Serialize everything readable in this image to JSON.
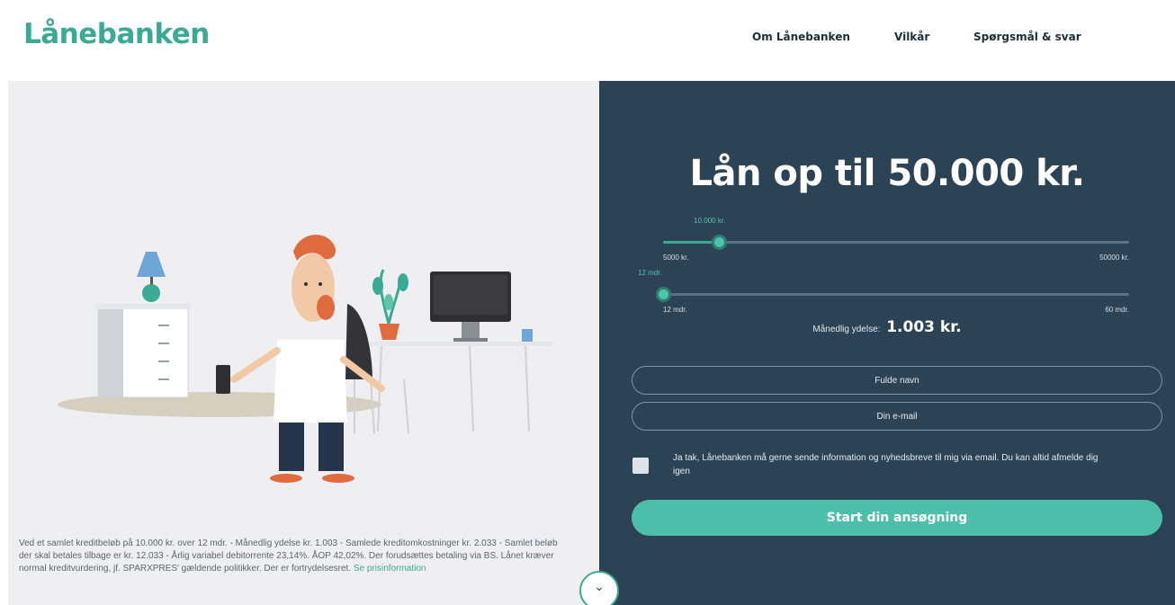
{
  "header": {
    "logo": "Lånebanken",
    "nav": [
      "Om Lånebanken",
      "Vilkår",
      "Spørgsmål & svar"
    ]
  },
  "form": {
    "headline": "Lån op til 50.000 kr.",
    "amount_slider": {
      "value_label": "10.000 kr.",
      "min_label": "5000 kr.",
      "max_label": "50000 kr.",
      "fill_fraction": 0.12
    },
    "term_slider": {
      "value_label": "12 mdr.",
      "min_label": "12 mdr.",
      "max_label": "60 mdr.",
      "fill_fraction": 0.0
    },
    "monthly_label": "Månedlig ydelse:",
    "monthly_value": "1.003 kr.",
    "name_placeholder": "Fulde navn",
    "email_placeholder": "Din e-mail",
    "consent_text": "Ja tak, Lånebanken må gerne sende information og nyhedsbreve til mig via email. Du kan altid afmelde dig igen",
    "submit_label": "Start din ansøgning"
  },
  "disclaimer": {
    "text": "Ved et samlet kreditbeløb på 10.000 kr. over 12 mdr. - Månedlig ydelse kr. 1.003 - Samlede kreditomkostninger kr. 2.033 - Samlet beløb der skal betales tilbage er kr. 12.033 - Årlig variabel debitorrente 23,14%. ÅOP 42,02%. Der forudsættes betaling via BS. Lånet kræver normal kreditvurdering, jf. SPARXPRES' gældende politikker. Der er fortrydelsesret.",
    "link": "Se prisinformation"
  },
  "colors": {
    "brand": "#3aaa94",
    "panel": "#2c4356",
    "left_bg": "#efeff1"
  },
  "icons": {
    "scroll": "chevron-down-icon"
  }
}
